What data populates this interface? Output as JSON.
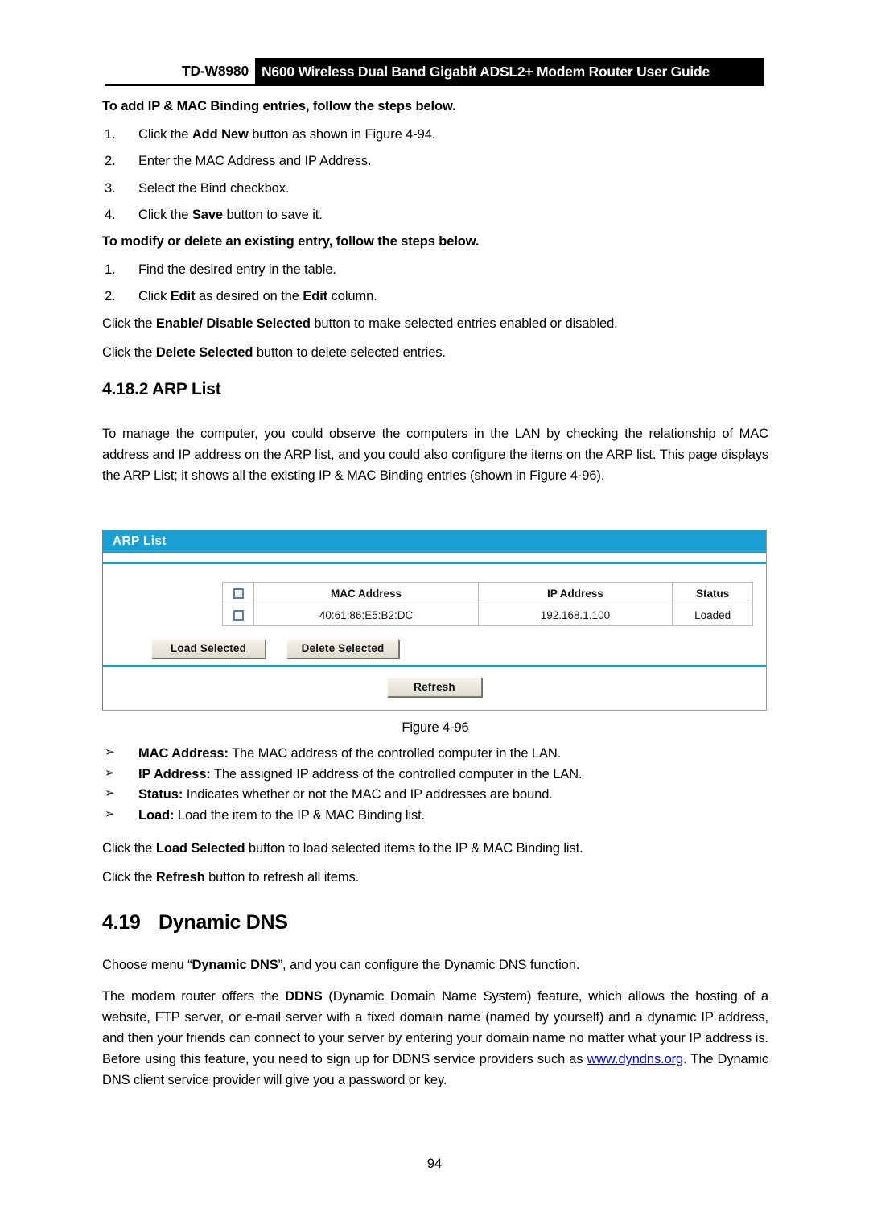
{
  "header": {
    "model": "TD-W8980",
    "title": "N600 Wireless Dual Band Gigabit ADSL2+ Modem Router User Guide"
  },
  "add_section": {
    "lead": "To add IP & MAC Binding entries, follow the steps below.",
    "steps": [
      {
        "num": "1.",
        "pre": "Click the ",
        "bold": "Add New",
        "post": " button as shown in Figure 4-94."
      },
      {
        "num": "2.",
        "pre": "Enter the MAC Address and IP Address.",
        "bold": "",
        "post": ""
      },
      {
        "num": "3.",
        "pre": "Select the Bind checkbox.",
        "bold": "",
        "post": ""
      },
      {
        "num": "4.",
        "pre": "Click the ",
        "bold": "Save",
        "post": " button to save it."
      }
    ]
  },
  "modify_section": {
    "lead": "To modify or delete an existing entry, follow the steps below.",
    "steps": [
      {
        "num": "1.",
        "pre": "Find the desired entry in the table.",
        "bold": "",
        "post": ""
      },
      {
        "num": "2.",
        "pre": "Click ",
        "bold": "Edit",
        "mid": " as desired on the ",
        "bold2": "Edit",
        "post": " column."
      }
    ],
    "note1_pre": "Click the ",
    "note1_bold": "Enable/ Disable Selected",
    "note1_post": " button to make selected entries enabled or disabled.",
    "note2_pre": "Click the ",
    "note2_bold": "Delete Selected",
    "note2_post": " button to delete selected entries."
  },
  "arp_section": {
    "heading_num": "4.18.2",
    "heading_text": "ARP List",
    "intro": "To manage the computer, you could observe the computers in the LAN by checking the relationship of MAC address and IP address on the ARP list, and you could also configure the items on the ARP list. This page displays the ARP List; it shows all the existing IP & MAC Binding entries (shown in Figure 4-96).",
    "figure_caption": "Figure 4-96",
    "bullet_glyph": "➢",
    "bullets": [
      {
        "term": "MAC Address:",
        "desc": " The MAC address of the controlled computer in the LAN."
      },
      {
        "term": "IP Address:",
        "desc": " The assigned IP address of the controlled computer in the LAN."
      },
      {
        "term": "Status:",
        "desc": " Indicates whether or not the MAC and IP addresses are bound."
      },
      {
        "term": "Load:",
        "desc": " Load the item to the IP & MAC Binding list."
      }
    ],
    "note1_pre": "Click the ",
    "note1_bold": "Load Selected",
    "note1_post": " button to load selected items to the IP & MAC Binding list.",
    "note2_pre": "Click the ",
    "note2_bold": "Refresh",
    "note2_post": " button to refresh all items."
  },
  "router_panel": {
    "title": "ARP List",
    "accent_color": "#1aa0d2",
    "columns": [
      "",
      "MAC Address",
      "IP Address",
      "Status"
    ],
    "rows": [
      {
        "mac": "40:61:86:E5:B2:DC",
        "ip": "192.168.1.100",
        "status": "Loaded"
      }
    ],
    "buttons": {
      "load_selected": "Load Selected",
      "delete_selected": "Delete Selected",
      "refresh": "Refresh"
    }
  },
  "ddns_section": {
    "heading_num": "4.19",
    "heading_text": "Dynamic DNS",
    "p1_pre": "Choose menu “",
    "p1_bold": "Dynamic DNS",
    "p1_post": "”, and you can configure the Dynamic DNS function.",
    "p2_pre": "The modem router offers the ",
    "p2_bold": "DDNS",
    "p2_mid": " (Dynamic Domain Name System) feature, which allows the hosting of a website, FTP server, or e-mail server with a fixed domain name (named by yourself) and a dynamic IP address, and then your friends can connect to your server by entering your domain name no matter what your IP address is. Before using this feature, you need to sign up for DDNS service providers such as ",
    "p2_link": "www.dyndns.org",
    "p2_post": ". The Dynamic DNS client service provider will give you a password or key."
  },
  "footer": {
    "page_number": "94"
  }
}
